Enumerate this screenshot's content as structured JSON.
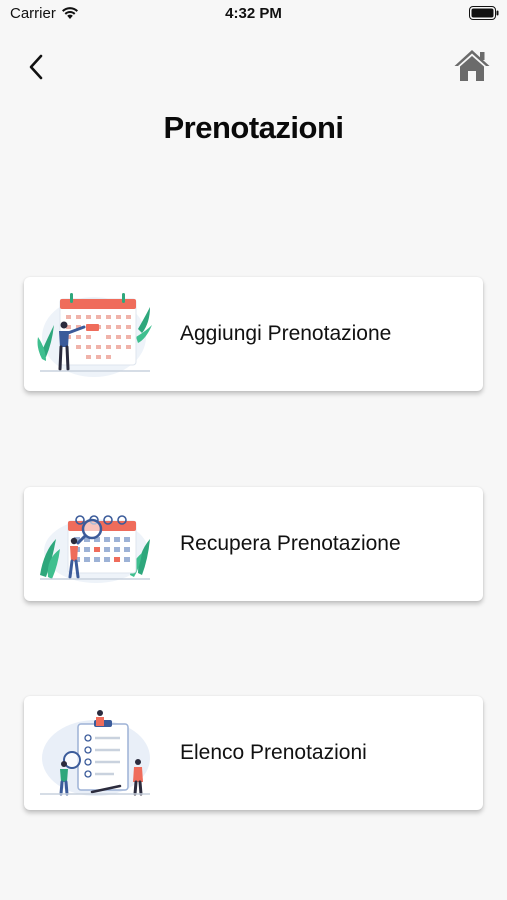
{
  "status_bar": {
    "carrier": "Carrier",
    "time": "4:32 PM",
    "icons": [
      "wifi-icon",
      "battery-icon"
    ]
  },
  "nav": {
    "back_icon": "chevron-left-icon",
    "home_icon": "home-icon"
  },
  "title": "Prenotazioni",
  "cards": [
    {
      "label": "Aggiungi Prenotazione",
      "illustration": "calendar-add-illustration"
    },
    {
      "label": "Recupera Prenotazione",
      "illustration": "calendar-search-illustration"
    },
    {
      "label": "Elenco Prenotazioni",
      "illustration": "checklist-illustration"
    }
  ],
  "colors": {
    "background": "#f7f7f7",
    "card": "#ffffff",
    "accent_red": "#ef6c5b",
    "accent_blue": "#3b5b9a",
    "leaf_green": "#2ea77c",
    "icon_gray": "#6b6b6b"
  }
}
